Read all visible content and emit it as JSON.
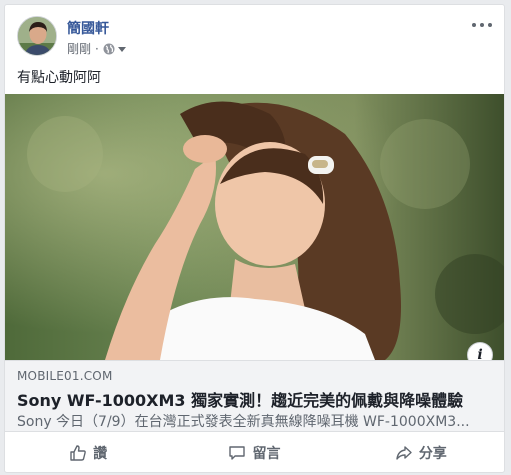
{
  "post": {
    "author": "簡國軒",
    "time": "剛剛",
    "separator": "·",
    "privacy_icon": "globe-icon",
    "text": "有點心動阿阿"
  },
  "link": {
    "domain": "MOBILE01.COM",
    "title": "Sony WF-1000XM3 獨家實測！趨近完美的佩戴與降噪體驗",
    "description": "Sony 今日（7/9）在台灣正式發表全新真無線降噪耳機 WF-1000XM3...",
    "info_icon_label": "i"
  },
  "actions": [
    {
      "label": "讚",
      "icon": "thumbs-up-icon"
    },
    {
      "label": "留言",
      "icon": "comment-icon"
    },
    {
      "label": "分享",
      "icon": "share-icon"
    }
  ],
  "colors": {
    "author_link": "#365899",
    "background": "#e9ebee",
    "link_box": "#f2f3f5"
  }
}
